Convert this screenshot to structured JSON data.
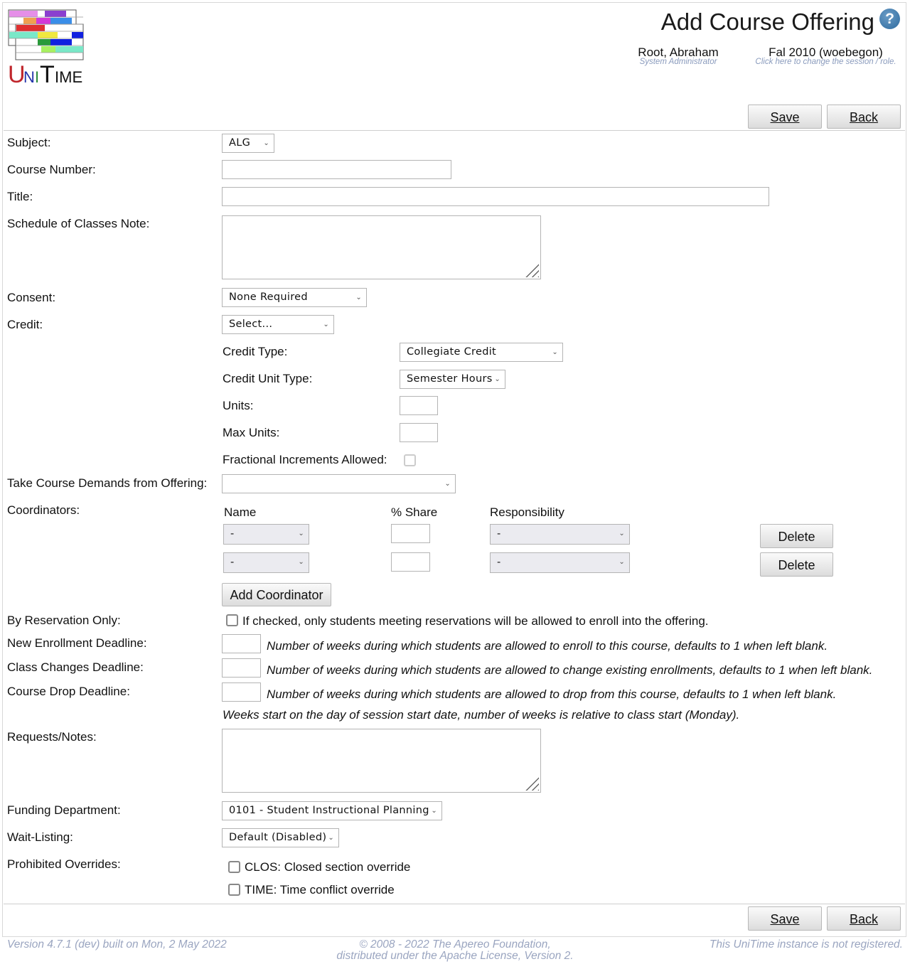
{
  "header": {
    "app_name": "UniTime",
    "title": "Add Course Offering",
    "help_icon": "help-icon",
    "user_name": "Root, Abraham",
    "user_role": "System Administrator",
    "session_name": "Fal 2010 (woebegon)",
    "session_hint": "Click here to change the session / role."
  },
  "buttons": {
    "save": "Save",
    "back": "Back",
    "add_coordinator": "Add Coordinator",
    "delete": "Delete"
  },
  "form": {
    "subject": {
      "label": "Subject:",
      "value": "ALG"
    },
    "course_number": {
      "label": "Course Number:",
      "value": ""
    },
    "title": {
      "label": "Title:",
      "value": ""
    },
    "schedule_note": {
      "label": "Schedule of Classes Note:",
      "value": ""
    },
    "consent": {
      "label": "Consent:",
      "value": "None Required"
    },
    "credit": {
      "label": "Credit:",
      "value": "Select..."
    },
    "credit_type": {
      "label": "Credit Type:",
      "value": "Collegiate Credit"
    },
    "credit_unit_type": {
      "label": "Credit Unit Type:",
      "value": "Semester Hours"
    },
    "units": {
      "label": "Units:",
      "value": ""
    },
    "max_units": {
      "label": "Max Units:",
      "value": ""
    },
    "fractional": {
      "label": "Fractional Increments Allowed:",
      "checked": false
    },
    "course_demands": {
      "label": "Take Course Demands from Offering:",
      "value": ""
    },
    "coordinators": {
      "label": "Coordinators:",
      "headers": [
        "Name",
        "% Share",
        "Responsibility"
      ],
      "rows": [
        {
          "name": "-",
          "share": "",
          "responsibility": "-"
        },
        {
          "name": "-",
          "share": "",
          "responsibility": "-"
        }
      ]
    },
    "by_reservation": {
      "label": "By Reservation Only:",
      "checked": false,
      "text": "If checked, only students meeting reservations will be allowed to enroll into the offering."
    },
    "new_enrollment": {
      "label": "New Enrollment Deadline:",
      "value": "",
      "hint": "Number of weeks during which students are allowed to enroll to this course, defaults to 1 when left blank."
    },
    "class_changes": {
      "label": "Class Changes Deadline:",
      "value": "",
      "hint": "Number of weeks during which students are allowed to change existing enrollments, defaults to 1 when left blank."
    },
    "course_drop": {
      "label": "Course Drop Deadline:",
      "value": "",
      "hint": "Number of weeks during which students are allowed to drop from this course, defaults to 1 when left blank."
    },
    "weeks_note": "Weeks start on the day of session start date, number of weeks is relative to class start (Monday).",
    "requests_notes": {
      "label": "Requests/Notes:",
      "value": ""
    },
    "funding_department": {
      "label": "Funding Department:",
      "value": "0101 - Student Instructional Planning"
    },
    "wait_listing": {
      "label": "Wait-Listing:",
      "value": "Default (Disabled)"
    },
    "prohibited_overrides": {
      "label": "Prohibited Overrides:",
      "options": [
        {
          "text": "CLOS: Closed section override",
          "checked": false
        },
        {
          "text": "TIME: Time conflict override",
          "checked": false
        }
      ]
    }
  },
  "footer": {
    "version": "Version 4.7.1 (dev) built on Mon, 2 May 2022",
    "copyright_line1": "© 2008 - 2022 The Apereo Foundation,",
    "copyright_line2": "distributed under the Apache License, Version 2.",
    "registration": "This UniTime instance is not registered."
  }
}
